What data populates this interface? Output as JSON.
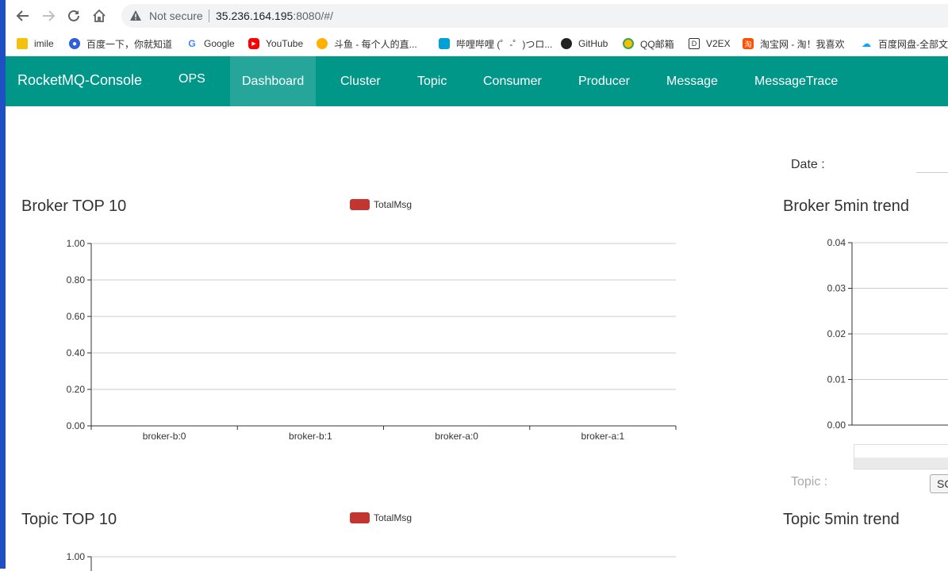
{
  "browser": {
    "security_label": "Not secure",
    "url_host": "35.236.164.195",
    "url_path": ":8080/#/",
    "bookmarks": [
      {
        "label": "imile",
        "icon": "folder-icon"
      },
      {
        "label": "百度一下，你就知道",
        "icon": "baidu-paw-icon"
      },
      {
        "label": "Google",
        "icon": "google-icon"
      },
      {
        "label": "YouTube",
        "icon": "youtube-icon"
      },
      {
        "label": "斗鱼 - 每个人的直...",
        "icon": "douyu-icon"
      },
      {
        "label": "哔哩哔哩 (゜-゜)つロ...",
        "icon": "bilibili-icon"
      },
      {
        "label": "GitHub",
        "icon": "github-icon"
      },
      {
        "label": "QQ邮箱",
        "icon": "qqmail-icon"
      },
      {
        "label": "V2EX",
        "icon": "v2ex-icon"
      },
      {
        "label": "淘宝网 - 淘！我喜欢",
        "icon": "taobao-icon"
      },
      {
        "label": "百度网盘-全部文",
        "icon": "baidu-pan-icon"
      }
    ]
  },
  "navbar": {
    "brand": "RocketMQ-Console",
    "items": [
      "OPS",
      "Dashboard",
      "Cluster",
      "Topic",
      "Consumer",
      "Producer",
      "Message",
      "MessageTrace"
    ],
    "active": "Dashboard",
    "color": "#009688"
  },
  "dashboard": {
    "date_label": "Date :",
    "topic_label": "Topic :",
    "topic_select_value": "SC"
  },
  "chart_data": [
    {
      "type": "bar",
      "title": "Broker TOP 10",
      "categories": [
        "broker-b:0",
        "broker-b:1",
        "broker-a:0",
        "broker-a:1"
      ],
      "series": [
        {
          "name": "TotalMsg",
          "values": [
            0,
            0,
            0,
            0
          ],
          "color": "#c23531"
        }
      ],
      "ylim": [
        0,
        1
      ],
      "yticks": [
        "1.00",
        "0.80",
        "0.60",
        "0.40",
        "0.20",
        "0.00"
      ],
      "legend": "top-center",
      "grid": true
    },
    {
      "type": "line",
      "title": "Broker 5min trend",
      "series": [],
      "ylim": [
        0,
        0.04
      ],
      "yticks": [
        "0.04",
        "0.03",
        "0.02",
        "0.01",
        "0.00"
      ],
      "grid": true
    },
    {
      "type": "bar",
      "title": "Topic TOP 10",
      "categories": [],
      "series": [
        {
          "name": "TotalMsg",
          "values": [],
          "color": "#c23531"
        }
      ],
      "ylim": [
        0,
        1
      ],
      "yticks": [
        "1.00"
      ],
      "legend": "top-center",
      "grid": true
    },
    {
      "type": "line",
      "title": "Topic 5min trend",
      "series": []
    }
  ]
}
